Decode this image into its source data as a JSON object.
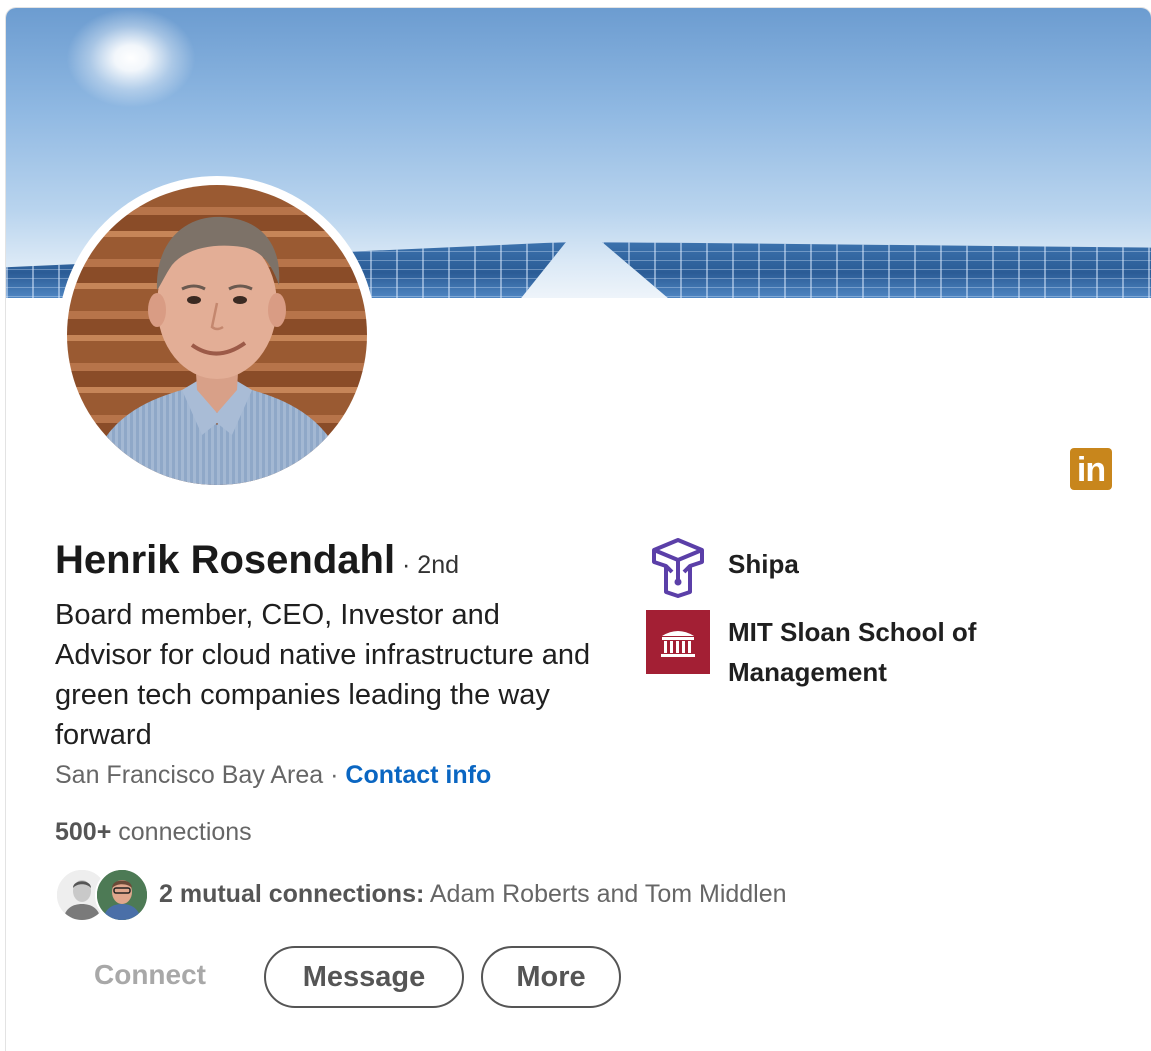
{
  "profile": {
    "name": "Henrik Rosendahl",
    "degree": " · 2nd",
    "headline": "Board member, CEO, Investor and Advisor for cloud native infrastructure and green tech companies leading the way forward",
    "location": "San Francisco Bay Area · ",
    "contact_info": "Contact info",
    "connections_count": "500+",
    "connections_suffix": " connections"
  },
  "mutual": {
    "label": "2 mutual connections:",
    "names": " Adam Roberts and Tom Middlen"
  },
  "experience": [
    {
      "name": "Shipa",
      "logo": "shipa-logo"
    },
    {
      "name": "MIT Sloan School of Management",
      "logo": "mit-logo"
    }
  ],
  "badge": {
    "text": "in",
    "color": "#c8861c"
  },
  "actions": {
    "connect": "Connect",
    "message": "Message",
    "more": "More"
  },
  "colors": {
    "link": "#0a66c2",
    "mit": "#a31f34",
    "shipa": "#5b3fa8"
  }
}
